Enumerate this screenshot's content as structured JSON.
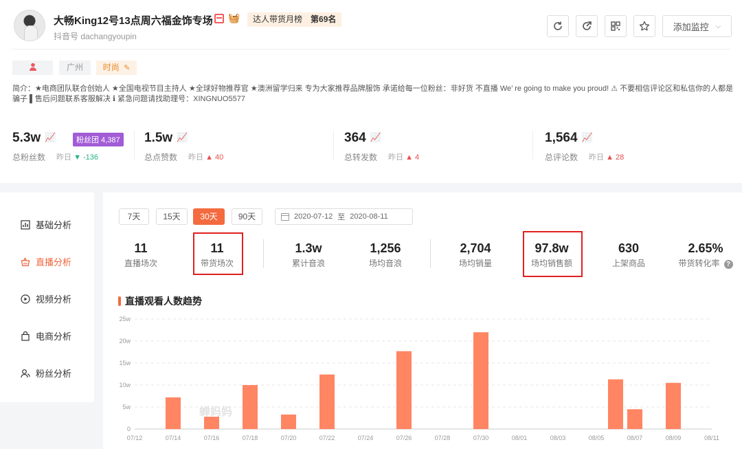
{
  "profile": {
    "name": "大畅King12号13点周六福金饰专场",
    "rank_badge": "达人带货月榜",
    "rank_value": "第69名",
    "douyin_id": "抖音号 dachangyoupin",
    "city_tag": "广州",
    "category_tag": "时尚",
    "bio": "简介：★电商团队联合创始人 ★全国电视节目主持人 ★全球好物推荐官 ★澳洲留学归来 专为大家推荐品牌服饰 承诺给每一位粉丝：非好货 不直播 We’ re going to make you proud! ⚠ 不要相信评论区和私信你的人都是骗子 ▌售后问题联系客服解决 ℹ 紧急问题请找助理号：XINGNUO5577"
  },
  "header_actions": {
    "monitor_label": "添加监控"
  },
  "stats": [
    {
      "value": "5.3w",
      "label": "总粉丝数",
      "yday_label": "昨日",
      "direction": "down",
      "yday_value": "-136",
      "badge": "粉丝团 4,387"
    },
    {
      "value": "1.5w",
      "label": "总点赞数",
      "yday_label": "昨日",
      "direction": "up",
      "yday_value": "40"
    },
    {
      "value": "364",
      "label": "总转发数",
      "yday_label": "昨日",
      "direction": "up",
      "yday_value": "4"
    },
    {
      "value": "1,564",
      "label": "总评论数",
      "yday_label": "昨日",
      "direction": "up",
      "yday_value": "28"
    }
  ],
  "sidebar": {
    "items": [
      {
        "label": "基础分析",
        "active": false
      },
      {
        "label": "直播分析",
        "active": true
      },
      {
        "label": "视频分析",
        "active": false
      },
      {
        "label": "电商分析",
        "active": false
      },
      {
        "label": "粉丝分析",
        "active": false
      }
    ]
  },
  "range_buttons": [
    {
      "label": "7天",
      "active": false
    },
    {
      "label": "15天",
      "active": false
    },
    {
      "label": "30天",
      "active": true
    },
    {
      "label": "90天",
      "active": false
    }
  ],
  "date_range": {
    "start": "2020-07-12",
    "sep": "至",
    "end": "2020-08-11"
  },
  "metrics": [
    {
      "value": "11",
      "label": "直播场次"
    },
    {
      "value": "11",
      "label": "带货场次"
    },
    {
      "value": "1.3w",
      "label": "累计音浪"
    },
    {
      "value": "1,256",
      "label": "场均音浪"
    },
    {
      "value": "2,704",
      "label": "场均销量"
    },
    {
      "value": "97.8w",
      "label": "场均销售额"
    },
    {
      "value": "630",
      "label": "上架商品"
    },
    {
      "value": "2.65%",
      "label": "带货转化率"
    }
  ],
  "chart_title": "直播观看人数趋势",
  "watermark": "蝉妈妈",
  "chart_data": {
    "type": "bar",
    "title": "直播观看人数趋势",
    "x": [
      "07/12",
      "07/13",
      "07/14",
      "07/15",
      "07/16",
      "07/17",
      "07/18",
      "07/19",
      "07/20",
      "07/21",
      "07/22",
      "07/23",
      "07/24",
      "07/25",
      "07/26",
      "07/27",
      "07/28",
      "07/29",
      "07/30",
      "07/31",
      "08/01",
      "08/02",
      "08/03",
      "08/04",
      "08/05",
      "08/06",
      "08/07",
      "08/08",
      "08/09",
      "08/10",
      "08/11"
    ],
    "values": [
      0,
      0,
      7.2,
      0,
      2.8,
      0,
      10,
      0,
      3.3,
      0,
      12.4,
      0,
      0,
      0,
      17.7,
      0,
      0,
      0,
      22,
      0,
      0,
      0,
      0,
      0,
      0,
      11.3,
      4.5,
      0,
      10.5,
      0,
      0
    ],
    "x_tick_labels": [
      "07/12",
      "07/14",
      "07/16",
      "07/18",
      "07/20",
      "07/22",
      "07/24",
      "07/26",
      "07/28",
      "07/30",
      "08/01",
      "08/03",
      "08/05",
      "08/07",
      "08/09",
      "08/11"
    ],
    "y_ticks": [
      "0",
      "5w",
      "10w",
      "15w",
      "20w",
      "25w"
    ],
    "ylim": [
      0,
      25
    ],
    "y_unit": "w",
    "bar_color": "#ff8563",
    "grid": true
  }
}
